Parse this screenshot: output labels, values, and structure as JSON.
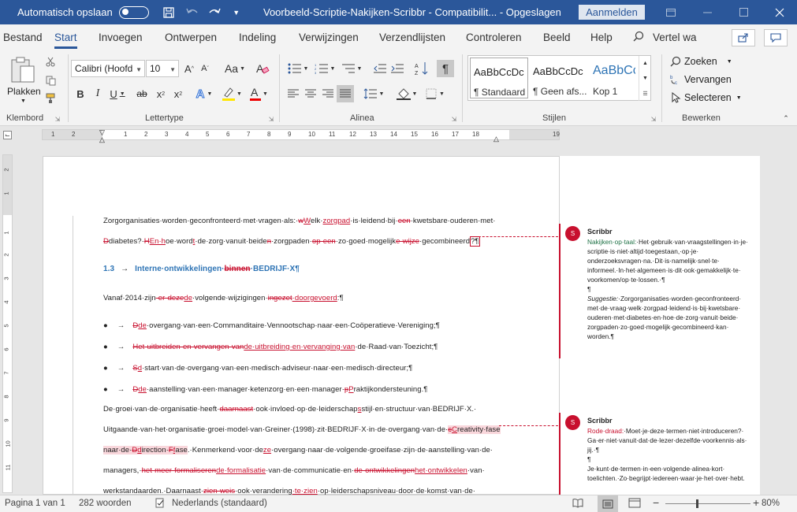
{
  "titlebar": {
    "autosave_label": "Automatisch opslaan",
    "doc_title": "Voorbeeld-Scriptie-Nakijken-Scribbr  -  Compatibilit...  -  Opgeslagen",
    "login_label": "Aanmelden"
  },
  "menu": {
    "items": [
      "Bestand",
      "Start",
      "Invoegen",
      "Ontwerpen",
      "Indeling",
      "Verwijzingen",
      "Verzendlijsten",
      "Controleren",
      "Beeld",
      "Help"
    ],
    "tell_me": "Vertel wa"
  },
  "ribbon": {
    "paste_label": "Plakken",
    "font_name": "Calibri (Hoofd",
    "font_size": "10",
    "change_case": "Aa",
    "clipboard_group": "Klembord",
    "font_group": "Lettertype",
    "paragraph_group": "Alinea",
    "styles_group": "Stijlen",
    "edit_group": "Bewerken",
    "styles": [
      {
        "sample": "AaBbCcDc",
        "name": "¶ Standaard"
      },
      {
        "sample": "AaBbCcDc",
        "name": "¶ Geen afs..."
      },
      {
        "sample": "AaBbCc",
        "name": "Kop 1"
      }
    ],
    "find_label": "Zoeken",
    "replace_label": "Vervangen",
    "select_label": "Selecteren"
  },
  "document": {
    "line1": "Zorgorganisaties·worden·geconfronteerd·met·vragen·als:·",
    "line1_del": "w",
    "line1_ins": "W",
    "line1_b": "elk·",
    "line1_ins2": "zorgpad",
    "line1_c": "·is·leidend·bij·",
    "line1_del2": "een",
    "line1_d": "·kwetsbare·ouderen·met·",
    "line2_del": "D",
    "line2_a": "diabetes?·",
    "line2_del2": "H",
    "line2_ins": "En·h",
    "line2_b": "oe·word",
    "line2_ins2": "t",
    "line2_c": "·de·zorg·vanuit·beide",
    "line2_del3": "n",
    "line2_d": "·zorgpaden·",
    "line2_del4": "op·een",
    "line2_e": "·zo·goed·mogelijk",
    "line2_del5": "e·wijze",
    "line2_f": "·gecombineerd",
    "line2_g": "?¶",
    "heading_num": "1.3",
    "heading_a": "Interne·ontwikkelingen·",
    "heading_del": "binnen",
    "heading_b": "·BEDRIJF·X¶",
    "line4_a": "Vanaf·2014·zijn",
    "line4_del": "·er·deze",
    "line4_ins": "de",
    "line4_b": "·volgende·wijzigingen·",
    "line4_del2": "ingezet",
    "line4_ins2": "·doorgevoerd",
    "line4_c": ":¶",
    "bullets": [
      {
        "del": "D",
        "ins": "de",
        "text": "·overgang·van·een·Commanditaire·Vennootschap·naar·een·Coöperatieve·Vereniging;¶"
      },
      {
        "del": "Het·uitbreiden·en·vervangen·van",
        "ins": "de·uitbreiding·en·vervanging·van",
        "text": "·de·Raad·van·Toezicht;¶"
      },
      {
        "del": "S",
        "ins": "d",
        "text": "·start·van·de·overgang·van·een·medisch·adviseur·naar·een·medisch·directeur;¶"
      },
      {
        "del": "D",
        "ins": "de",
        "text": "·aanstelling·van·een·manager·ketenzorg·en·een·manager·",
        "del2": "p",
        "ins2": "P",
        "text2": "raktijkondersteuning.¶"
      }
    ],
    "para_l1_a": "De·groei·van·de·organisatie·heeft·",
    "para_l1_del": "daarnaast",
    "para_l1_b": "·ook·invloed·op·de·leiderschap",
    "para_l1_ins": "s",
    "para_l1_c": "stijl·en·structuur·van·BEDRIJF·X.·",
    "para_l2_a": "Uitgaande·van·het·organisatie·groei·model·van·Greiner·(1998)·zit·BEDRIJF·X·in·de·overgang·van·de·",
    "para_l2_del": "c",
    "para_l2_ins": "C",
    "para_l2_b": "reativity·fase",
    "para_l3_a": "naar·de·",
    "para_l3_del": "D",
    "para_l3_ins": "d",
    "para_l3_b": "irection·",
    "para_l3_del2": "F",
    "para_l3_ins2": "f",
    "para_l3_c": "ase",
    "para_l3_d": ".·Kenmerkend·voor·de",
    "para_l3_ins3": "ze",
    "para_l3_e": "·overgang·naar·de·volgende·groeifase·zijn·de·aanstelling·van·de·",
    "para_l4_a": "managers,·",
    "para_l4_del": "het·meer·formaliseren",
    "para_l4_ins": "de·formalisatie",
    "para_l4_b": "·van·de·communicatie·en·",
    "para_l4_del2": "de·ontwikkelingen",
    "para_l4_ins2": "het·ontwikkelen",
    "para_l4_c": "·van·",
    "para_l5_a": "werkstandaarden.·Daarnaast·",
    "para_l5_del": "zien·weis",
    "para_l5_b": "·ook·verandering",
    "para_l5_ins": "·te·zien",
    "para_l5_c": "·op·leiderschapsniveau·door·de·komst·van·de·"
  },
  "comments": [
    {
      "avatar": "S",
      "author": "Scribbr",
      "label": "Nakijken·op·taal:",
      "lines": [
        "Nakijken·op·taal:·Het·gebruik·van·vraagstellingen·in·je·",
        "scriptie·is·niet·altijd·toegestaan,·op·je·",
        "onderzoeksvragen·na.·Dit·is·namelijk·snel·te·",
        "informeel.·In·het·algemeen·is·dit·ook·gemakkelijk·te·",
        "voorkomen/op·te·lossen.·¶",
        "¶",
        "Suggestie:·Zorgorganisaties·worden·geconfronteerd·",
        "met·de·vraag·welk·zorgpad·leidend·is·bij·kwetsbare·",
        "ouderen·met·diabetes·en·hoe·de·zorg·vanuit·beide·",
        "zorgpaden·zo·goed·mogelijk·gecombineerd·kan·",
        "worden.¶"
      ]
    },
    {
      "avatar": "S",
      "author": "Scribbr",
      "label": "Rode·draad:",
      "lines": [
        "Rode·draad:·Moet·je·deze·termen·niet·introduceren?·",
        "Ga·er·niet·vanuit·dat·de·lezer·dezelfde·voorkennis·als·",
        "jij.·¶",
        "¶",
        "Je·kunt·de·termen·in·een·volgende·alinea·kort·",
        "toelichten.·Zo·begrijpt·iedereen·waar·je·het·over·hebt."
      ]
    }
  ],
  "statusbar": {
    "page": "Pagina 1 van 1",
    "words": "282 woorden",
    "language": "Nederlands (standaard)",
    "zoom": "80%",
    "zoom_level": 0.5
  },
  "ruler_numbers": [
    "1",
    "2",
    "1",
    "2",
    "3",
    "4",
    "5",
    "6",
    "7",
    "8",
    "9",
    "10",
    "11",
    "12",
    "13",
    "14",
    "15",
    "16",
    "17",
    "18",
    "19"
  ],
  "vruler_numbers": [
    "2",
    "1",
    "1",
    "2",
    "3",
    "4",
    "5",
    "6",
    "7",
    "8",
    "9",
    "10",
    "11"
  ]
}
